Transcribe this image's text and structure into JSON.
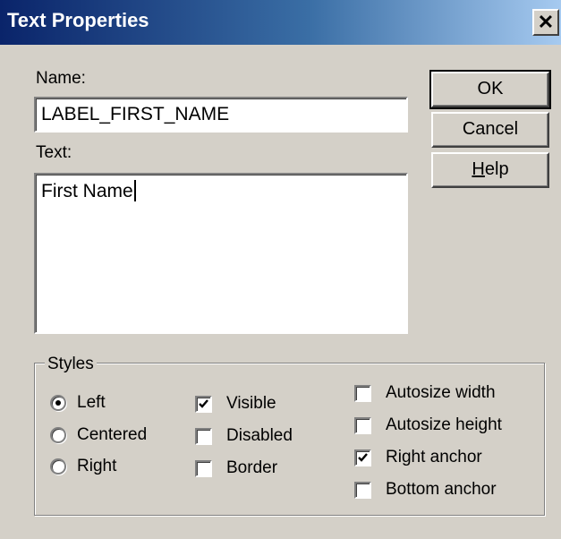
{
  "window": {
    "title": "Text Properties",
    "close_glyph": "✕"
  },
  "name_field": {
    "label": "Name:",
    "value": "LABEL_FIRST_NAME"
  },
  "text_field": {
    "label": "Text:",
    "value": "First Name"
  },
  "buttons": {
    "ok": "OK",
    "cancel": "Cancel",
    "help_mnemonic": "H",
    "help_rest": "elp"
  },
  "styles": {
    "legend": "Styles",
    "alignment": [
      {
        "label": "Left",
        "selected": true
      },
      {
        "label": "Centered",
        "selected": false
      },
      {
        "label": "Right",
        "selected": false
      }
    ],
    "flags": [
      {
        "label": "Visible",
        "checked": true
      },
      {
        "label": "Disabled",
        "checked": false
      },
      {
        "label": "Border",
        "checked": false
      }
    ],
    "anchors": [
      {
        "label": "Autosize width",
        "checked": false
      },
      {
        "label": "Autosize height",
        "checked": false
      },
      {
        "label": "Right anchor",
        "checked": true
      },
      {
        "label": "Bottom anchor",
        "checked": false
      }
    ]
  },
  "colors": {
    "dialog_face": "#d4d0c8",
    "title_gradient_start": "#0a246a",
    "title_gradient_end": "#a6caf0"
  }
}
